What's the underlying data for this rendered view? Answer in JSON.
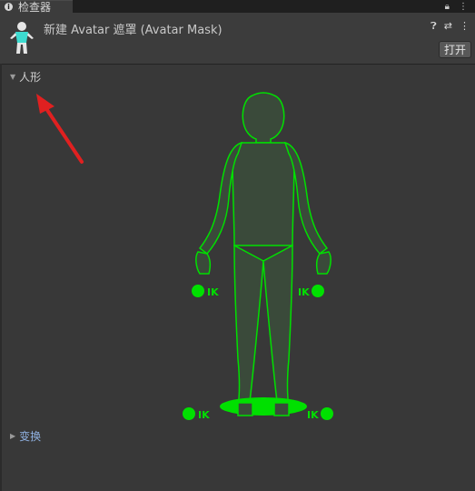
{
  "tab": {
    "title": "检查器",
    "icon": "info-icon"
  },
  "tab_icons": {
    "lock": "lock-icon",
    "menu": "menu-icon"
  },
  "header": {
    "title": "新建 Avatar 遮罩 (Avatar Mask)",
    "open_label": "打开",
    "help": "help-icon",
    "settings": "sliders-icon",
    "more": "more-icon"
  },
  "sections": {
    "humanoid": "人形",
    "transform": "变换"
  },
  "ik_labels": {
    "left_hand": "IK",
    "right_hand": "IK",
    "left_foot": "IK",
    "right_foot": "IK"
  },
  "colors": {
    "active_green": "#00e000",
    "body_fill": "#3a4a3a",
    "arrow_red": "#e02020"
  }
}
